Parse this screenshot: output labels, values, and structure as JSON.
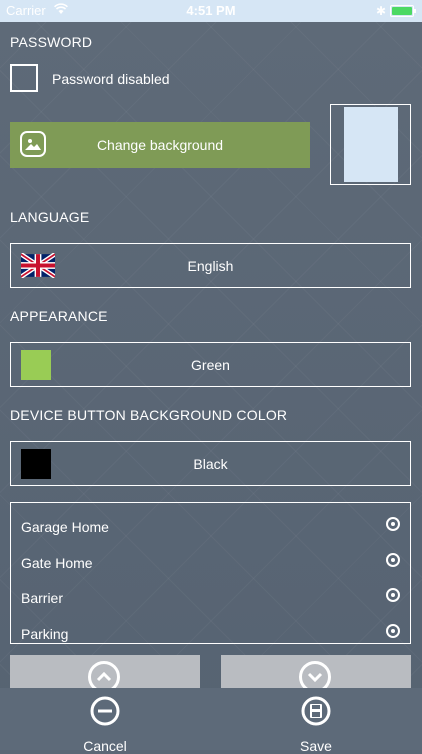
{
  "status": {
    "carrier": "Carrier",
    "time": "4:51 PM",
    "bt": "✱"
  },
  "password": {
    "heading": "PASSWORD",
    "checkbox_label": "Password disabled"
  },
  "background": {
    "button_label": "Change background"
  },
  "language": {
    "heading": "LANGUAGE",
    "value": "English"
  },
  "appearance": {
    "heading": "APPEARANCE",
    "value": "Green",
    "swatch_color": "#99cc55"
  },
  "device_button": {
    "heading": "DEVICE BUTTON BACKGROUND COLOR",
    "value": "Black",
    "swatch_color": "#000000"
  },
  "devices": [
    {
      "label": "Garage Home"
    },
    {
      "label": "Gate Home"
    },
    {
      "label": "Barrier"
    },
    {
      "label": "Parking"
    }
  ],
  "bottom": {
    "cancel_label": "Cancel",
    "save_label": "Save"
  }
}
